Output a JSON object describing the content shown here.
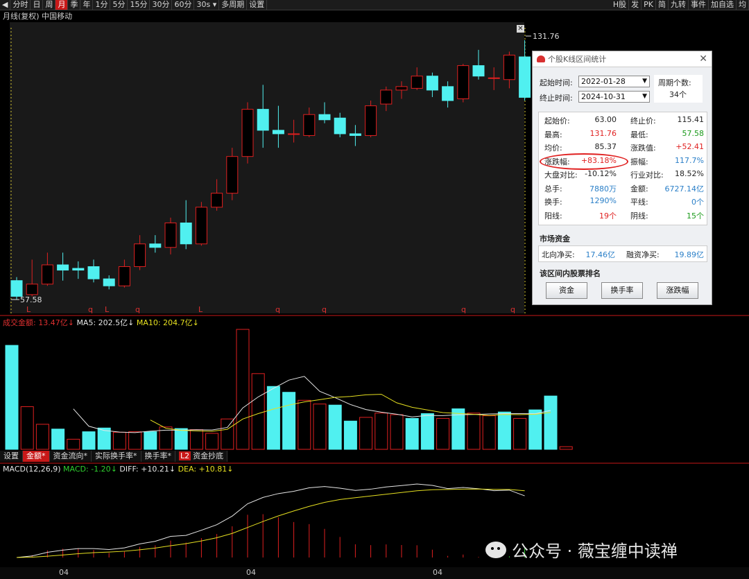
{
  "toolbar": {
    "left_items": [
      "分时",
      "日",
      "周",
      "月",
      "季",
      "年",
      "1分",
      "5分",
      "15分",
      "30分",
      "60分",
      "30s",
      "多周期",
      "设置"
    ],
    "active": "月",
    "right_items": [
      "H股",
      "发",
      "PK",
      "简",
      "九转",
      "事件",
      "加自选",
      "均"
    ]
  },
  "chart": {
    "title": "月线(复权) 中国移动",
    "high_label": "131.76",
    "low_label": "57.58",
    "markers": [
      "L",
      "q",
      "L",
      "q",
      "L",
      "q",
      "q",
      "q",
      "q"
    ]
  },
  "stats_panel": {
    "title": "个股K线区间统计",
    "start_label": "起始时间:",
    "start_value": "2022-01-28",
    "end_label": "终止时间:",
    "end_value": "2024-10-31",
    "periods_label": "周期个数:",
    "periods_value": "34个",
    "rows": [
      {
        "l1": "起始价:",
        "v1": "63.00",
        "c1": "dark",
        "l2": "终止价:",
        "v2": "115.41",
        "c2": "dark"
      },
      {
        "l1": "最高:",
        "v1": "131.76",
        "c1": "red",
        "l2": "最低:",
        "v2": "57.58",
        "c2": "green"
      },
      {
        "l1": "均价:",
        "v1": "85.37",
        "c1": "dark",
        "l2": "涨跌值:",
        "v2": "+52.41",
        "c2": "red"
      },
      {
        "l1": "涨跌幅:",
        "v1": "+83.18%",
        "c1": "red",
        "l2": "振幅:",
        "v2": "117.7%",
        "c2": "blue"
      },
      {
        "l1": "大盘对比:",
        "v1": "-10.12%",
        "c1": "dark",
        "l2": "行业对比:",
        "v2": "18.52%",
        "c2": "dark"
      },
      {
        "l1": "总手:",
        "v1": "7880万",
        "c1": "blue",
        "l2": "金额:",
        "v2": "6727.14亿",
        "c2": "blue"
      },
      {
        "l1": "换手:",
        "v1": "1290%",
        "c1": "blue",
        "l2": "平线:",
        "v2": "0个",
        "c2": "blue"
      },
      {
        "l1": "阳线:",
        "v1": "19个",
        "c1": "red",
        "l2": "阴线:",
        "v2": "15个",
        "c2": "green"
      }
    ],
    "fund_title": "市场资金",
    "north_label": "北向净买:",
    "north_value": "17.46亿",
    "margin_label": "融资净买:",
    "margin_value": "19.89亿",
    "rank_title": "该区间内股票排名",
    "buttons": [
      "资金",
      "换手率",
      "涨跌幅"
    ]
  },
  "volume": {
    "label": "成交金额:",
    "value": "13.47亿",
    "ma5": "MA5: 202.5亿",
    "ma10": "MA10: 204.7亿"
  },
  "tabs": [
    "设置",
    "金额",
    "资金流向",
    "实际换手率",
    "换手率",
    "资金抄底"
  ],
  "tabs_active": "金额",
  "tab_badge": "L2",
  "macd": {
    "name": "MACD(12,26,9)",
    "macd": "MACD: -1.20",
    "diff": "DIFF: +10.21",
    "dea": "DEA: +10.81"
  },
  "date_ticks": [
    "04",
    "04",
    "04"
  ],
  "watermark": "公众号 · 薇宝缠中读禅",
  "colors": {
    "up": "#e02020",
    "down": "#50f0f0",
    "ma5": "#e6e6e6",
    "ma10": "#e6e020",
    "panel_red_circle": "#e02020"
  },
  "candles": [
    {
      "o": 63.0,
      "c": 58.5,
      "h": 64,
      "l": 57.58
    },
    {
      "o": 59.0,
      "c": 62.0,
      "h": 69,
      "l": 58.5
    },
    {
      "o": 62.0,
      "c": 67.5,
      "h": 71,
      "l": 61.5
    },
    {
      "o": 67.5,
      "c": 66.0,
      "h": 71,
      "l": 63.0
    },
    {
      "o": 66.5,
      "c": 66.0,
      "h": 68.5,
      "l": 63.5
    },
    {
      "o": 67.0,
      "c": 63.5,
      "h": 69,
      "l": 62.5
    },
    {
      "o": 63.5,
      "c": 61.5,
      "h": 64.5,
      "l": 60.5
    },
    {
      "o": 61.5,
      "c": 67.0,
      "h": 69,
      "l": 61.0
    },
    {
      "o": 67.0,
      "c": 73.5,
      "h": 76,
      "l": 66.0
    },
    {
      "o": 73.5,
      "c": 72.5,
      "h": 76,
      "l": 71.0
    },
    {
      "o": 72.5,
      "c": 79.5,
      "h": 81,
      "l": 70.5
    },
    {
      "o": 79.5,
      "c": 73.5,
      "h": 86,
      "l": 72.0
    },
    {
      "o": 73.5,
      "c": 84.0,
      "h": 85.5,
      "l": 73.0
    },
    {
      "o": 84.0,
      "c": 88.0,
      "h": 92,
      "l": 83.0
    },
    {
      "o": 88.0,
      "c": 98.5,
      "h": 101,
      "l": 86.0
    },
    {
      "o": 98.5,
      "c": 112.0,
      "h": 114,
      "l": 96.5
    },
    {
      "o": 112.0,
      "c": 106.0,
      "h": 119,
      "l": 101.0
    },
    {
      "o": 106.0,
      "c": 105.0,
      "h": 113,
      "l": 101.0
    },
    {
      "o": 105.0,
      "c": 105.0,
      "h": 109,
      "l": 102.5
    },
    {
      "o": 104.5,
      "c": 110.5,
      "h": 112.5,
      "l": 104.0
    },
    {
      "o": 110.5,
      "c": 109.0,
      "h": 114,
      "l": 108.0
    },
    {
      "o": 109.5,
      "c": 105.0,
      "h": 111,
      "l": 104.0
    },
    {
      "o": 105.0,
      "c": 104.5,
      "h": 107.5,
      "l": 101.5
    },
    {
      "o": 104.5,
      "c": 113.0,
      "h": 114.5,
      "l": 104.0
    },
    {
      "o": 113.5,
      "c": 117.5,
      "h": 118.5,
      "l": 111.5
    },
    {
      "o": 117.5,
      "c": 118.5,
      "h": 120,
      "l": 115.0
    },
    {
      "o": 118.0,
      "c": 121.5,
      "h": 124,
      "l": 117.5
    },
    {
      "o": 121.5,
      "c": 117.5,
      "h": 122.5,
      "l": 115.5
    },
    {
      "o": 118.5,
      "c": 114.5,
      "h": 120,
      "l": 112.5
    },
    {
      "o": 115.0,
      "c": 124.5,
      "h": 125,
      "l": 114.0
    },
    {
      "o": 124.5,
      "c": 121.5,
      "h": 129,
      "l": 120.5
    },
    {
      "o": 121.0,
      "c": 121.0,
      "h": 124,
      "l": 117.5
    },
    {
      "o": 120.5,
      "c": 127.5,
      "h": 128.5,
      "l": 118.0
    },
    {
      "o": 127.0,
      "c": 115.41,
      "h": 131.76,
      "l": 114.5
    }
  ],
  "amounts": [
    195,
    80,
    47,
    38,
    19,
    33,
    40,
    32,
    33,
    33,
    42,
    39,
    37,
    30,
    57,
    225,
    142,
    118,
    107,
    92,
    85,
    83,
    53,
    60,
    68,
    65,
    58,
    67,
    58,
    76,
    68,
    63,
    70,
    58,
    74,
    100,
    5
  ],
  "amount_up": [
    0,
    1,
    1,
    0,
    1,
    0,
    0,
    1,
    1,
    0,
    1,
    0,
    1,
    1,
    1,
    1,
    1,
    0,
    0,
    1,
    1,
    0,
    0,
    1,
    1,
    1,
    0,
    0,
    1,
    0,
    1,
    1,
    0,
    1,
    0,
    0,
    1
  ]
}
